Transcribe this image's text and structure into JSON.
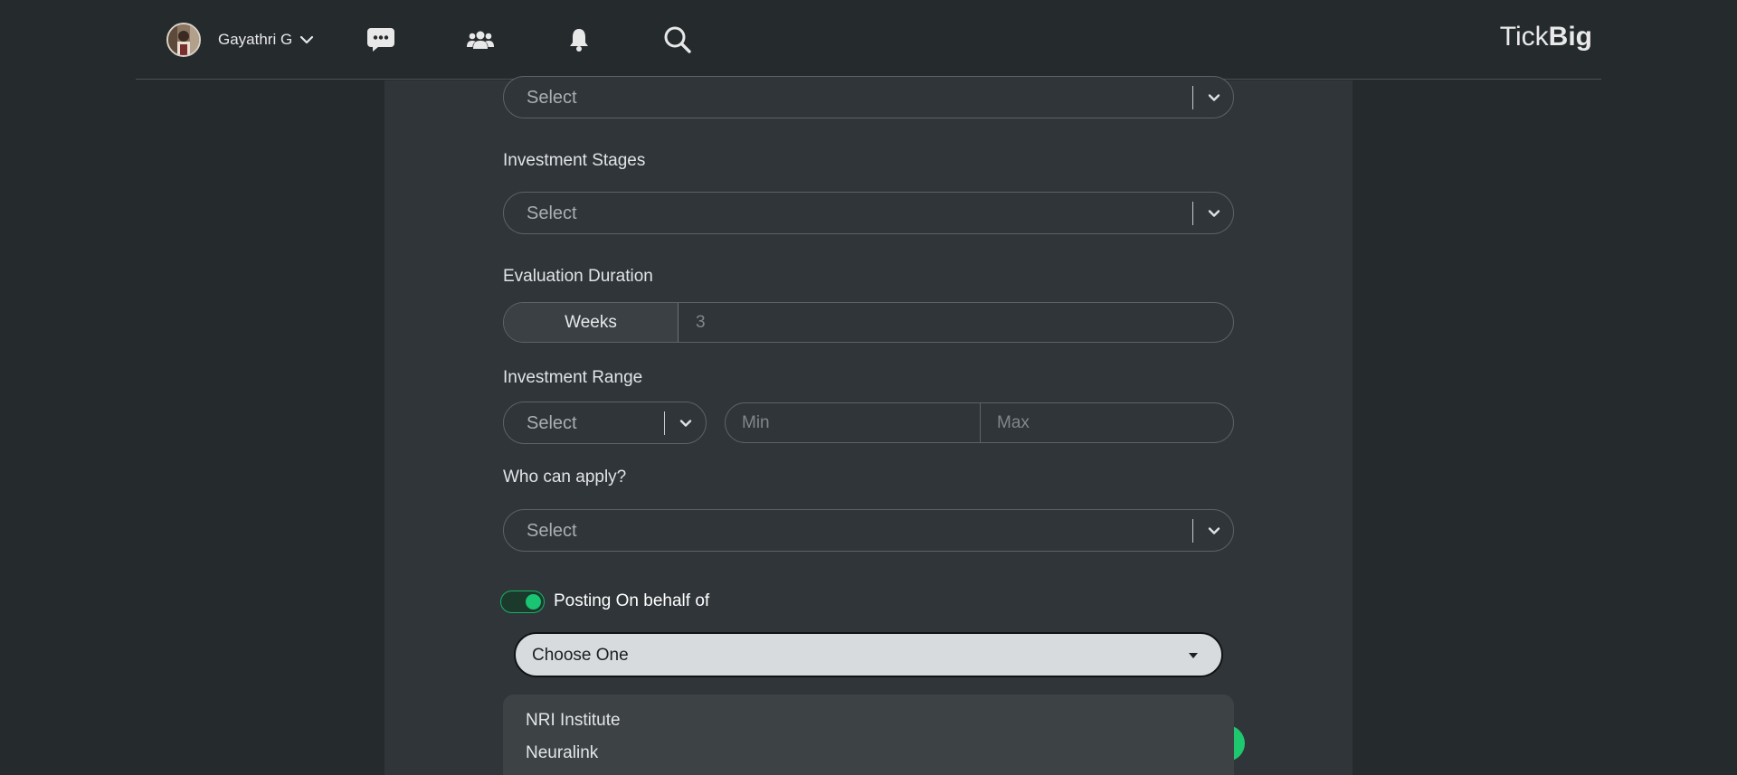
{
  "header": {
    "user_name": "Gayathri G",
    "brand_light": "Tick",
    "brand_bold": "Big",
    "icons": [
      "chat-icon",
      "people-icon",
      "bell-icon",
      "search-icon"
    ]
  },
  "form": {
    "top_select_placeholder": "Select",
    "investment_stages": {
      "label": "Investment Stages",
      "placeholder": "Select"
    },
    "evaluation_duration": {
      "label": "Evaluation Duration",
      "unit": "Weeks",
      "value": "3"
    },
    "investment_range": {
      "label": "Investment Range",
      "currency_placeholder": "Select",
      "min_placeholder": "Min",
      "max_placeholder": "Max"
    },
    "who_can_apply": {
      "label": "Who can apply?",
      "placeholder": "Select"
    },
    "posting_on_behalf": {
      "label": "Posting On behalf of",
      "enabled": true
    },
    "organization_select": {
      "value": "Choose One",
      "options": [
        "NRI Institute",
        "Neuralink"
      ]
    }
  },
  "colors": {
    "background": "#252a2d",
    "panel": "#2f3539",
    "accent_green": "#19c472"
  }
}
